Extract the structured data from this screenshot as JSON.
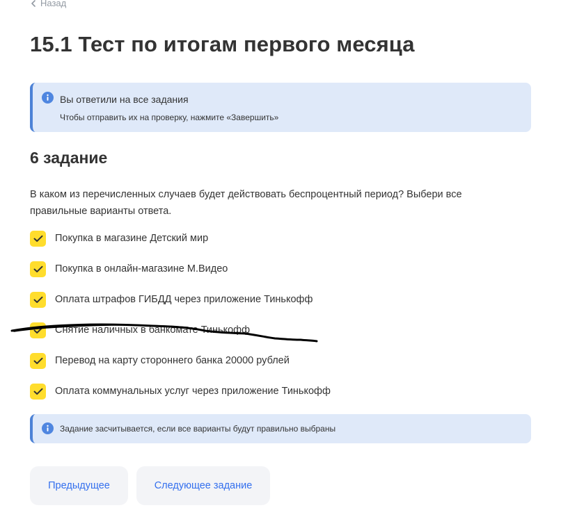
{
  "nav": {
    "back_label": "Назад"
  },
  "page": {
    "title": "15.1 Тест по итогам первого месяца"
  },
  "notice_top": {
    "title": "Вы ответили на все задания",
    "text": "Чтобы отправить их на проверку, нажмите «Завершить»",
    "icon": "info-icon"
  },
  "task": {
    "title": "6 задание",
    "question": "В каком из перечисленных случаев будет действовать беспроцентный период? Выбери все правильные варианты ответа.",
    "options": [
      {
        "label": "Покупка в магазине Детский мир",
        "checked": true
      },
      {
        "label": "Покупка в онлайн-магазине М.Видео",
        "checked": true
      },
      {
        "label": "Оплата штрафов ГИБДД через приложение Тинькофф",
        "checked": true
      },
      {
        "label": "Снятие наличных в банкомате Тинькофф",
        "checked": true
      },
      {
        "label": "Перевод на карту стороннего банка 20000 рублей",
        "checked": true
      },
      {
        "label": "Оплата коммунальных услуг через приложение Тинькофф",
        "checked": true
      }
    ]
  },
  "notice_bottom": {
    "text": "Задание засчитывается, если все варианты будут правильно выбраны",
    "icon": "info-icon"
  },
  "buttons": {
    "prev_label": "Предыдущее",
    "next_label": "Следующее задание"
  },
  "colors": {
    "checkbox": "#ffdd2d",
    "notice_bg": "#dfe9f9",
    "notice_border": "#4d82d6",
    "link": "#336fee",
    "button_bg": "#f3f4f7",
    "scribble": "#000000"
  }
}
